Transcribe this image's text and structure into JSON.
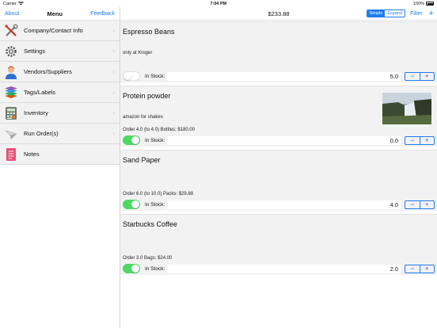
{
  "status": {
    "carrier": "Carrier",
    "time": "7:04 PM",
    "battery": "100%"
  },
  "sidebar": {
    "about": "About",
    "title": "Menu",
    "feedback": "Feedback",
    "items": [
      {
        "label": "Company/Contact Info",
        "icon": "tools-icon"
      },
      {
        "label": "Settings",
        "icon": "gear-icon"
      },
      {
        "label": "Vendors/Suppliers",
        "icon": "person-icon"
      },
      {
        "label": "Tags/Labels",
        "icon": "layers-icon"
      },
      {
        "label": "Inventory",
        "icon": "calculator-icon"
      },
      {
        "label": "Run Order(s)",
        "icon": "send-icon"
      },
      {
        "label": "Notes",
        "icon": "notepad-icon"
      }
    ]
  },
  "main": {
    "total": "$233.88",
    "view_simple": "Simple",
    "view_expand": "Expand",
    "filter": "Filter",
    "add": "+"
  },
  "items": [
    {
      "name": "Espresso Beans",
      "note": "only at Kroger",
      "order": "",
      "stock_label": "In Stock:",
      "stock": "5.0",
      "tracked": false
    },
    {
      "name": "Protein powder",
      "note": "amazon for shakes",
      "order": "Order 4.0 (to 4.0) Bottles: $180.00",
      "stock_label": "In Stock:",
      "stock": "0.0",
      "tracked": true
    },
    {
      "name": "Sand Paper",
      "note": "",
      "order": "Order 6.0 (to 10.0) Packs: $29.88",
      "stock_label": "In Stock:",
      "stock": "4.0",
      "tracked": true
    },
    {
      "name": "Starbucks Coffee",
      "note": "",
      "order": "Order 3.0 Bags: $24.00",
      "stock_label": "In Stock:",
      "stock": "2.0",
      "tracked": true
    }
  ],
  "stepper": {
    "minus": "−",
    "plus": "+"
  },
  "colors": {
    "accent": "#1e7cf2",
    "toggle_on": "#4cd964",
    "card_bg": "#f2f2f2"
  }
}
